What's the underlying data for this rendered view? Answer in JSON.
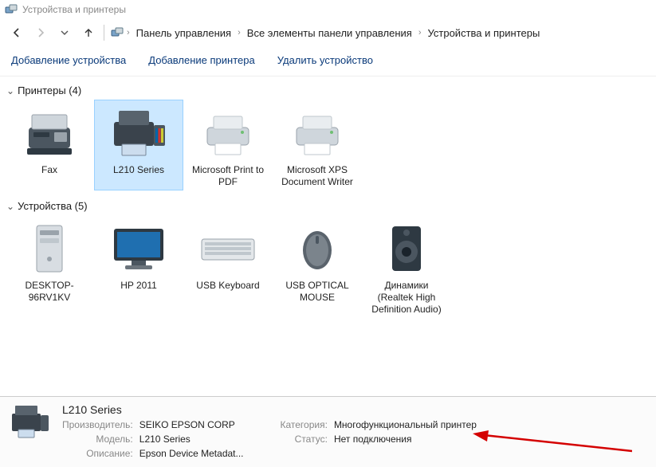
{
  "window": {
    "title": "Устройства и принтеры"
  },
  "nav": {
    "back": "←",
    "forward": "→",
    "recent": "⌄",
    "up": "↑"
  },
  "breadcrumb": {
    "items": [
      "Панель управления",
      "Все элементы панели управления",
      "Устройства и принтеры"
    ]
  },
  "toolbar": {
    "add_device": "Добавление устройства",
    "add_printer": "Добавление принтера",
    "remove_device": "Удалить устройство"
  },
  "groups": {
    "printers": {
      "label": "Принтеры (4)",
      "items": [
        {
          "name": "Fax",
          "icon": "fax"
        },
        {
          "name": "L210 Series",
          "icon": "epson",
          "selected": true
        },
        {
          "name": "Microsoft Print to PDF",
          "icon": "printer"
        },
        {
          "name": "Microsoft XPS Document Writer",
          "icon": "printer"
        }
      ]
    },
    "devices": {
      "label": "Устройства (5)",
      "items": [
        {
          "name": "DESKTOP-96RV1KV",
          "icon": "pc"
        },
        {
          "name": "HP 2011",
          "icon": "monitor"
        },
        {
          "name": "USB Keyboard",
          "icon": "keyboard"
        },
        {
          "name": "USB OPTICAL MOUSE",
          "icon": "mouse"
        },
        {
          "name": "Динамики (Realtek High Definition Audio)",
          "icon": "speaker"
        }
      ]
    }
  },
  "details": {
    "name": "L210 Series",
    "manufacturer_label": "Производитель:",
    "manufacturer": "SEIKO EPSON CORP",
    "model_label": "Модель:",
    "model": "L210 Series",
    "description_label": "Описание:",
    "description": "Epson Device Metadat...",
    "category_label": "Категория:",
    "category": "Многофункциональный принтер",
    "status_label": "Статус:",
    "status": "Нет подключения"
  }
}
